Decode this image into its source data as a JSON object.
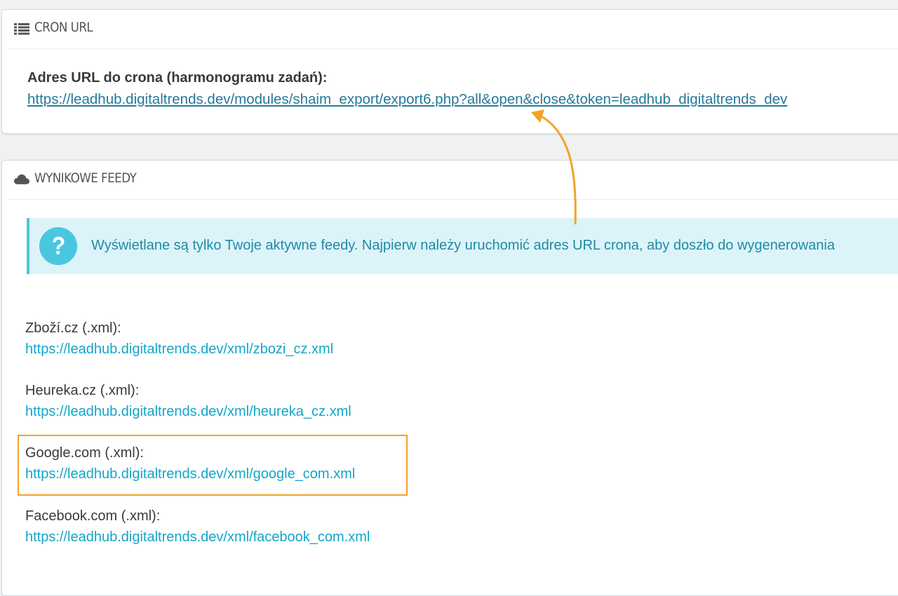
{
  "cron_panel": {
    "title": "CRON URL",
    "icon": "list-icon",
    "label": "Adres URL do crona (harmonogramu zadań):",
    "url": "https://leadhub.digitaltrends.dev/modules/shaim_export/export6.php?all&open&close&token=leadhub_digitaltrends_dev"
  },
  "feeds_panel": {
    "title": "WYNIKOWE FEEDY",
    "icon": "cloud-icon",
    "info_alert": {
      "icon": "question-circle-icon",
      "text": "Wyświetlane są tylko Twoje aktywne feedy. Najpierw należy uruchomić adres URL crona, aby doszło do wygenerowania"
    },
    "feeds": [
      {
        "label": "Zboží.cz (.xml):",
        "url": "https://leadhub.digitaltrends.dev/xml/zbozi_cz.xml"
      },
      {
        "label": "Heureka.cz (.xml):",
        "url": "https://leadhub.digitaltrends.dev/xml/heureka_cz.xml"
      },
      {
        "label": "Google.com (.xml):",
        "url": "https://leadhub.digitaltrends.dev/xml/google_com.xml",
        "highlighted": true
      },
      {
        "label": "Facebook.com (.xml):",
        "url": "https://leadhub.digitaltrends.dev/xml/facebook_com.xml"
      }
    ]
  },
  "colors": {
    "link_cron": "#25799a",
    "link_feed": "#14a5c9",
    "alert_bg": "#dcf4f9",
    "alert_border": "#4ac7e0",
    "annotation": "#f1a227"
  }
}
